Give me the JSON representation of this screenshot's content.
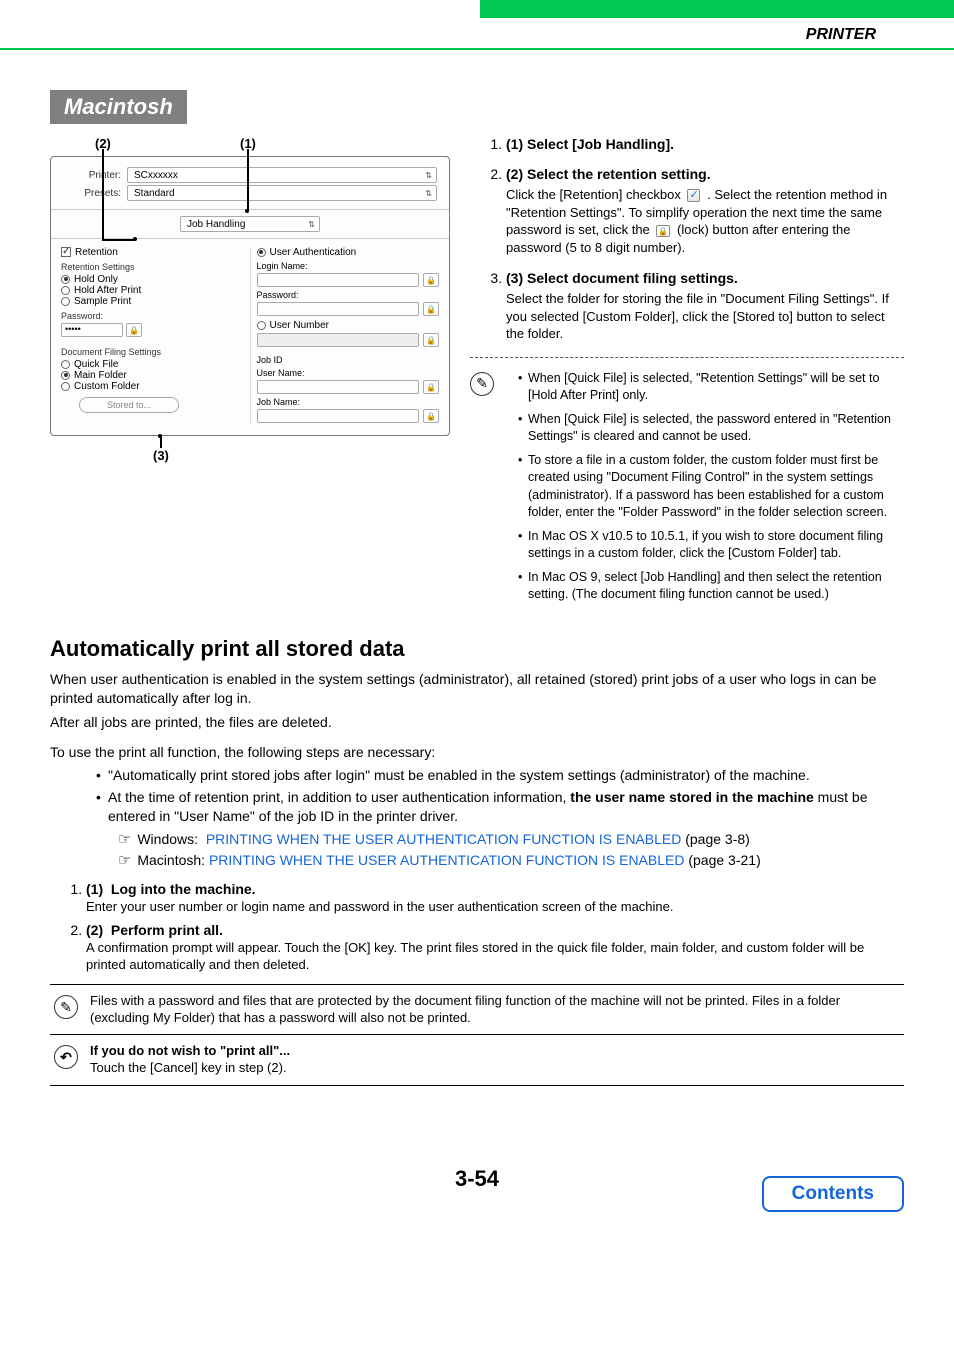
{
  "header": {
    "title": "PRINTER"
  },
  "section_label": "Macintosh",
  "callouts": {
    "c1": "(1)",
    "c2": "(2)",
    "c3": "(3)"
  },
  "dialog": {
    "printer_label": "Printer:",
    "printer_value": "SCxxxxxx",
    "presets_label": "Presets:",
    "presets_value": "Standard",
    "tab_value": "Job Handling",
    "left": {
      "retention": "Retention",
      "settings_h": "Retention Settings",
      "opts": [
        "Hold Only",
        "Hold After Print",
        "Sample Print"
      ],
      "password": "Password:",
      "password_val": "•••••",
      "filing_h": "Document Filing Settings",
      "filing_opts": [
        "Quick File",
        "Main Folder",
        "Custom Folder"
      ],
      "stored_to": "Stored to..."
    },
    "right": {
      "auth": "User Authentication",
      "login": "Login Name:",
      "password": "Password:",
      "usernum": "User Number",
      "jobid": "Job ID",
      "username": "User Name:",
      "jobname": "Job Name:"
    }
  },
  "steps": [
    {
      "n": "(1)",
      "title": "Select [Job Handling]."
    },
    {
      "n": "(2)",
      "title": "Select the retention setting.",
      "body_a": "Click the [Retention] checkbox ",
      "body_b": " . Select the retention method in \"Retention Settings\". To simplify operation the next time the same password is set, click the ",
      "body_c": " (lock) button after entering the password (5 to 8 digit number)."
    },
    {
      "n": "(3)",
      "title": "Select document filing settings.",
      "body": "Select the folder for storing the file in \"Document Filing Settings\". If you selected [Custom Folder], click the [Stored to] button to select the folder."
    }
  ],
  "notes": [
    "When [Quick File] is selected, \"Retention Settings\" will be set to [Hold After Print] only.",
    "When [Quick File] is selected, the password entered in \"Retention Settings\" is cleared and cannot be used.",
    "To store a file in a custom folder, the custom folder must first be created using \"Document Filing Control\" in the system settings (administrator). If a password has been established for a custom folder, enter the \"Folder Password\" in the folder selection screen.",
    "In Mac OS X v10.5 to 10.5.1, if you wish to store document filing settings in a custom folder, click the [Custom Folder] tab.",
    "In Mac OS 9, select [Job Handling] and then select the retention setting. (The document filing function cannot be used.)"
  ],
  "auto": {
    "heading": "Automatically print all stored data",
    "p1": "When user authentication is enabled in the system settings (administrator), all retained (stored) print jobs of a user who logs in can be printed automatically after log in.",
    "p2": "After all jobs are printed, the files are deleted.",
    "p3": "To use the print all function, the following steps are necessary:",
    "b1": "\"Automatically print stored jobs after login\" must be enabled in the system settings (administrator) of the machine.",
    "b2a": "At the time of retention print, in addition to user authentication information, ",
    "b2b": "the user name stored in the machine",
    "b2c": " must be entered in \"User Name\" of the job ID in the printer driver.",
    "links": {
      "win_label": "Windows:",
      "win_link": "PRINTING WHEN THE USER AUTHENTICATION FUNCTION IS ENABLED",
      "win_page": " (page 3-8)",
      "mac_label": "Macintosh:",
      "mac_link": "PRINTING WHEN THE USER AUTHENTICATION FUNCTION IS ENABLED",
      "mac_page": " (page 3-21)"
    },
    "step1_t": "Log into the machine.",
    "step1_b": "Enter your user number or login name and password in the user authentication screen of the machine.",
    "step2_t": "Perform print all.",
    "step2_b": "A confirmation prompt will appear. Touch the [OK] key. The print files stored in the quick file folder, main folder, and custom folder will be printed automatically and then deleted."
  },
  "info1": "Files with a password and files that are protected by the document filing function of the machine will not be printed. Files in a folder (excluding My Folder) that has a password will also not be printed.",
  "info2_t": "If you do not wish to \"print all\"...",
  "info2_b": "Touch the [Cancel] key in step (2).",
  "page_number": "3-54",
  "contents": "Contents"
}
